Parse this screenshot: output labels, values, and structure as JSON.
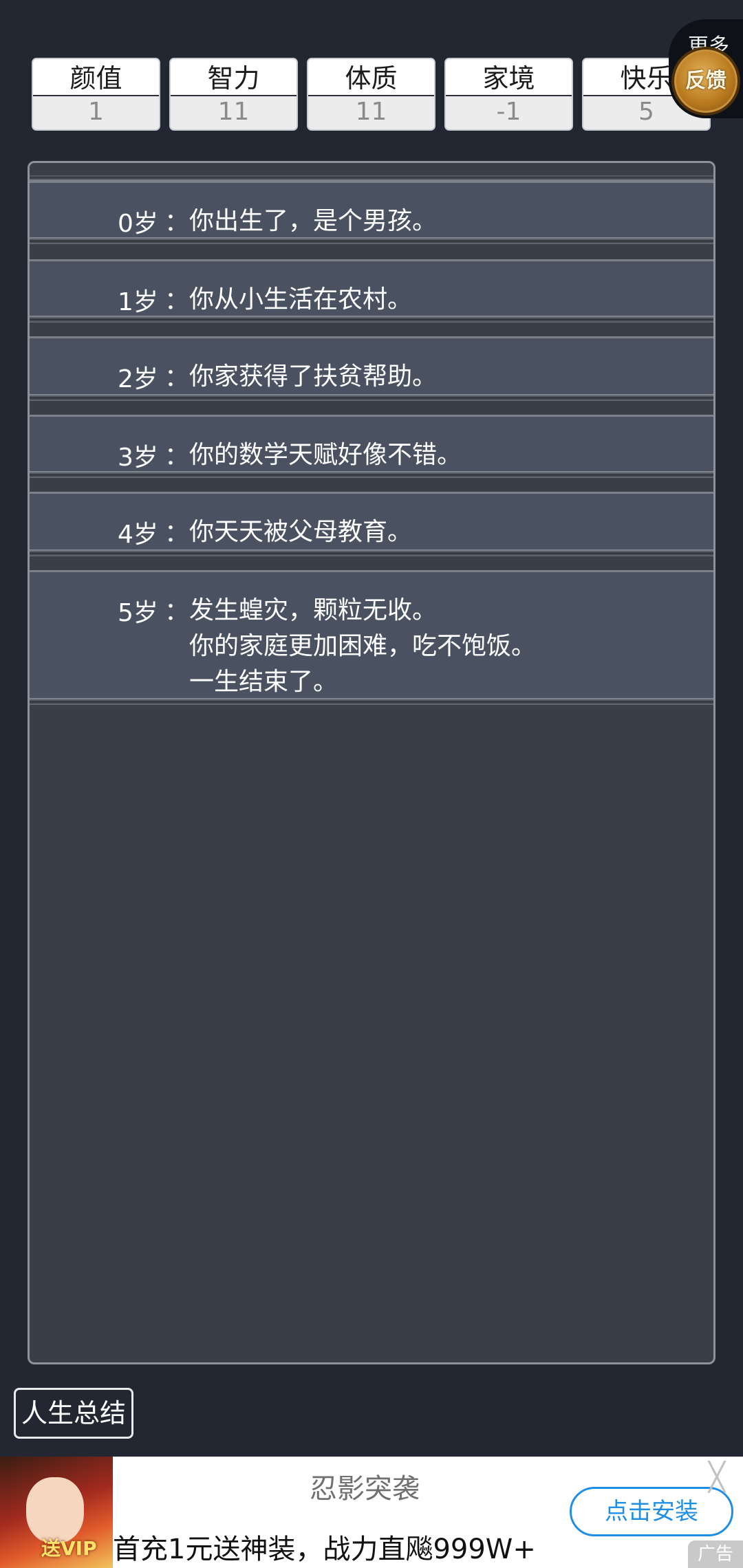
{
  "stats": [
    {
      "name": "颜值",
      "value": "1"
    },
    {
      "name": "智力",
      "value": "11"
    },
    {
      "name": "体质",
      "value": "11"
    },
    {
      "name": "家境",
      "value": "-1"
    },
    {
      "name": "快乐",
      "value": "5"
    }
  ],
  "more_button": {
    "label": "更多",
    "feedback_label": "反馈"
  },
  "log": [
    {
      "age": "0岁",
      "colon": "：",
      "lines": [
        "你出生了，是个男孩。"
      ]
    },
    {
      "age": "1岁",
      "colon": "：",
      "lines": [
        "你从小生活在农村。"
      ]
    },
    {
      "age": "2岁",
      "colon": "：",
      "lines": [
        "你家获得了扶贫帮助。"
      ]
    },
    {
      "age": "3岁",
      "colon": "：",
      "lines": [
        "你的数学天赋好像不错。"
      ]
    },
    {
      "age": "4岁",
      "colon": "：",
      "lines": [
        "你天天被父母教育。"
      ]
    },
    {
      "age": "5岁",
      "colon": "：",
      "lines": [
        "发生蝗灾，颗粒无收。",
        "你的家庭更加困难，吃不饱饭。",
        "一生结束了。"
      ]
    }
  ],
  "summary_button": "人生总结",
  "ad": {
    "title": "忍影突袭",
    "description": "首充1元送神装，战力直飚999W+",
    "install": "点击安装",
    "close": "╳",
    "tag": "广告",
    "badge": "送VIP"
  }
}
